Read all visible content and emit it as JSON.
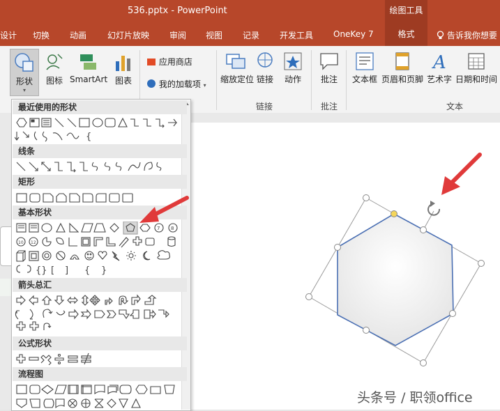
{
  "window": {
    "title": "536.pptx  -  PowerPoint",
    "context_title": "绘图工具"
  },
  "tabs": [
    "设计",
    "切换",
    "动画",
    "幻灯片放映",
    "审阅",
    "视图",
    "记录",
    "开发工具",
    "OneKey 7",
    "格式"
  ],
  "tell_me": "告诉我你想要",
  "ribbon": {
    "shapes": "形状",
    "icons": "图标",
    "smartart": "SmartArt",
    "chart": "图表",
    "store": "应用商店",
    "my_addins": "我的加载项",
    "zoom": "缩放定位",
    "link": "链接",
    "action": "动作",
    "comment": "批注",
    "textbox": "文本框",
    "header_footer": "页眉和页脚",
    "wordart": "艺术字",
    "datetime": "日期和时间",
    "group_links": "链接",
    "group_comments": "批注",
    "group_text": "文本"
  },
  "shapes_menu": {
    "sections": [
      "最近使用的形状",
      "线条",
      "矩形",
      "基本形状",
      "箭头总汇",
      "公式形状",
      "流程图"
    ]
  },
  "watermark": "头条号 / 职领office",
  "colors": {
    "accent": "#b7472a",
    "arrow": "#e03a3a",
    "hexagon_stroke": "#4a6fb3"
  }
}
